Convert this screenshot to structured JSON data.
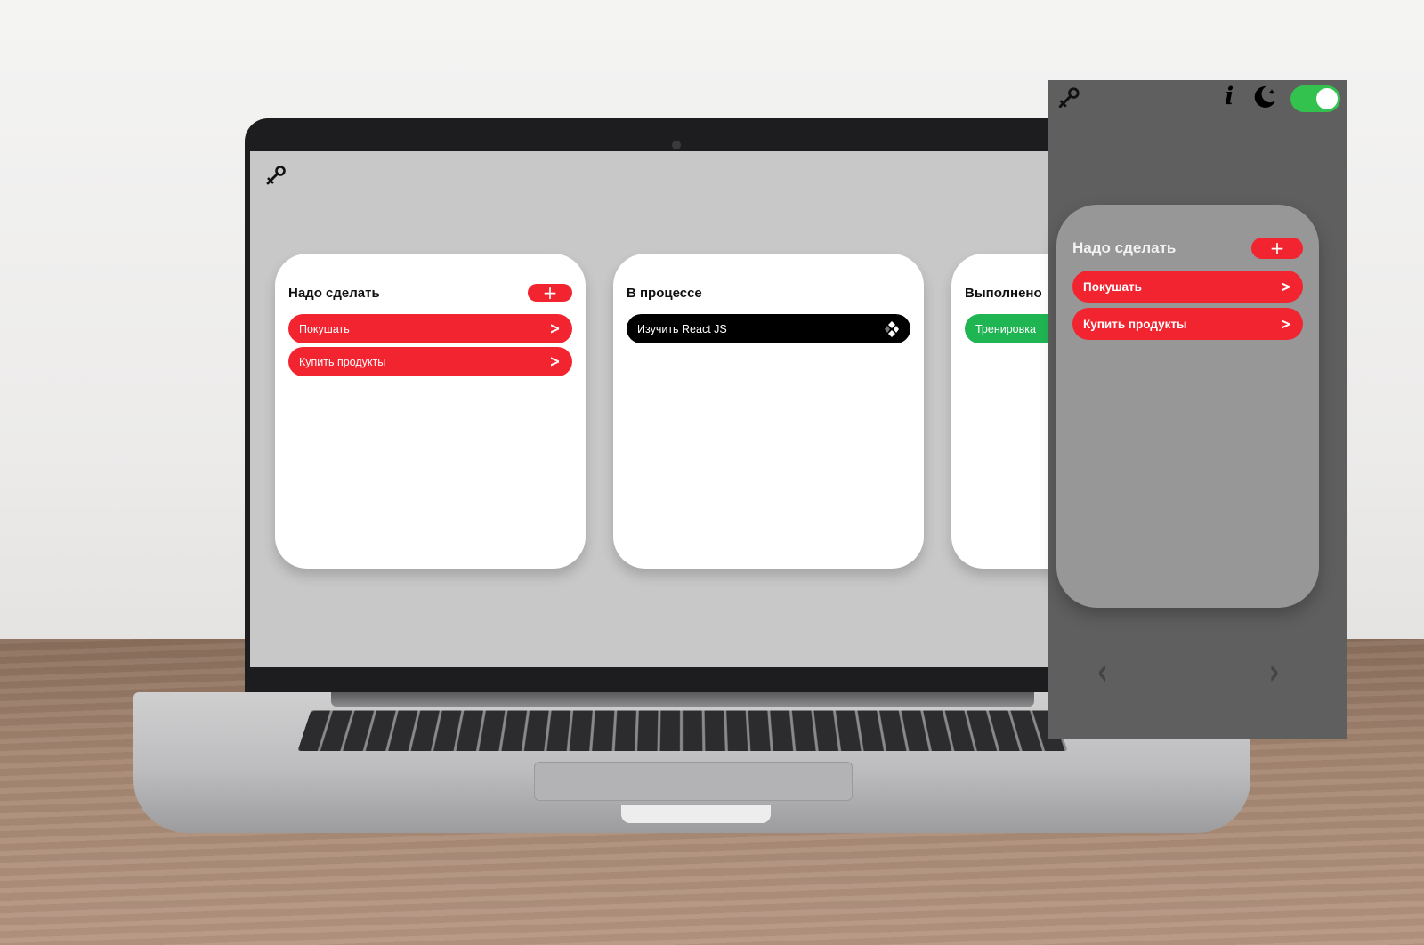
{
  "colors": {
    "accent_red": "#f2242f",
    "in_progress_black": "#000000",
    "done_green": "#1fb552",
    "desktop_bg": "#c8c8c8",
    "mobile_bg": "#5f5f5f",
    "toggle_on": "#33c24d"
  },
  "desktop": {
    "logo_icon": "key-icon",
    "columns": [
      {
        "title": "Надо сделать",
        "add_label": "+",
        "tasks": [
          {
            "label": "Покушать",
            "icon": "chevron-right-icon"
          },
          {
            "label": "Купить продукты",
            "icon": "chevron-right-icon"
          }
        ]
      },
      {
        "title": "В процессе",
        "tasks": [
          {
            "label": "Изучить React JS",
            "icon": "drag-handle-icon"
          }
        ]
      },
      {
        "title": "Выполнено",
        "tasks": [
          {
            "label": "Тренировка"
          }
        ]
      }
    ]
  },
  "mobile": {
    "logo_icon": "key-icon",
    "info_label": "i",
    "theme_icon": "moon-icon",
    "dark_mode_toggle": "on",
    "column": {
      "title": "Надо сделать",
      "add_label": "+",
      "tasks": [
        {
          "label": "Покушать",
          "icon": "chevron-right-icon"
        },
        {
          "label": "Купить продукты",
          "icon": "chevron-right-icon"
        }
      ]
    },
    "nav": {
      "prev": "‹",
      "next": "›"
    }
  }
}
